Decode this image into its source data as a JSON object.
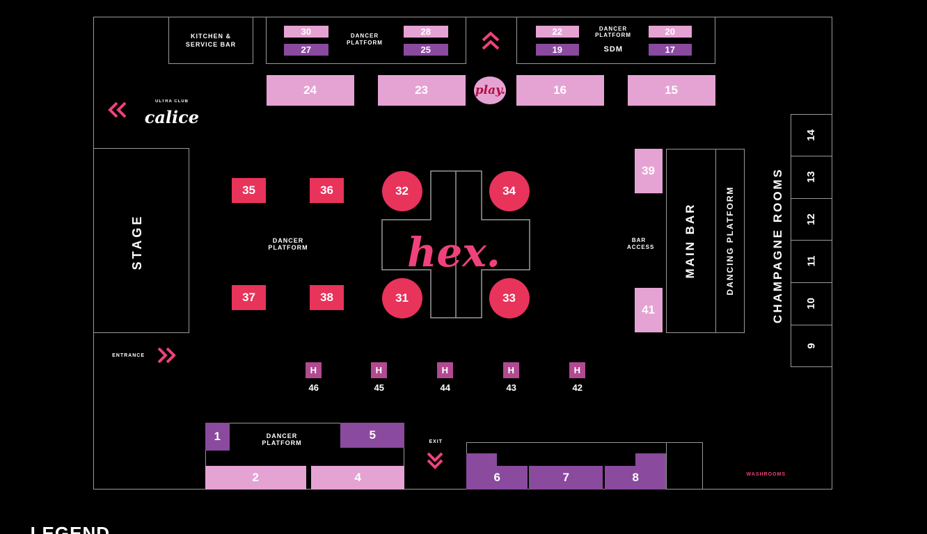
{
  "legend_title": "LEGEND",
  "labels": {
    "washrooms": "WASHROOMS",
    "exit": "EXIT",
    "entrance": "ENTRANCE",
    "stage": "STAGE",
    "main_bar": "MAIN BAR",
    "dancing_platform": "DANCING PLATFORM",
    "bar_access": "BAR ACCESS",
    "dancer_platform": "DANCER PLATFORM",
    "champagne_rooms": "CHAMPAGNE ROOMS",
    "kitchen_service_bar": "KITCHEN & SERVICE BAR",
    "sdm": "SDM"
  },
  "logos": {
    "center": "hex.",
    "play": "play.",
    "venue": "calice",
    "venue_sub": "ULTRA CLUB"
  },
  "tables": {
    "t1": "1",
    "t2": "2",
    "t4": "4",
    "t5": "5",
    "t6": "6",
    "t7": "7",
    "t8": "8",
    "t15": "15",
    "t16": "16",
    "t17": "17",
    "t19": "19",
    "t20": "20",
    "t22": "22",
    "t23": "23",
    "t24": "24",
    "t25": "25",
    "t27": "27",
    "t28": "28",
    "t30": "30",
    "t31": "31",
    "t32": "32",
    "t33": "33",
    "t34": "34",
    "t35": "35",
    "t36": "36",
    "t37": "37",
    "t38": "38",
    "t39": "39",
    "t41": "41"
  },
  "high_tops": [
    {
      "number": "42",
      "badge": "H"
    },
    {
      "number": "43",
      "badge": "H"
    },
    {
      "number": "44",
      "badge": "H"
    },
    {
      "number": "45",
      "badge": "H"
    },
    {
      "number": "46",
      "badge": "H"
    }
  ],
  "champagne_rooms": [
    "9",
    "10",
    "11",
    "12",
    "13",
    "14"
  ],
  "colors": {
    "pink": "#e5a3d4",
    "purple": "#8a4a9e",
    "red": "#e8335a",
    "badge": "#b14a90",
    "arrow": "#f0427a",
    "line": "#9a9a9a"
  },
  "icons": {
    "exit_arrow": "chevron-double-icon",
    "entrance_arrow": "chevron-double-icon"
  }
}
